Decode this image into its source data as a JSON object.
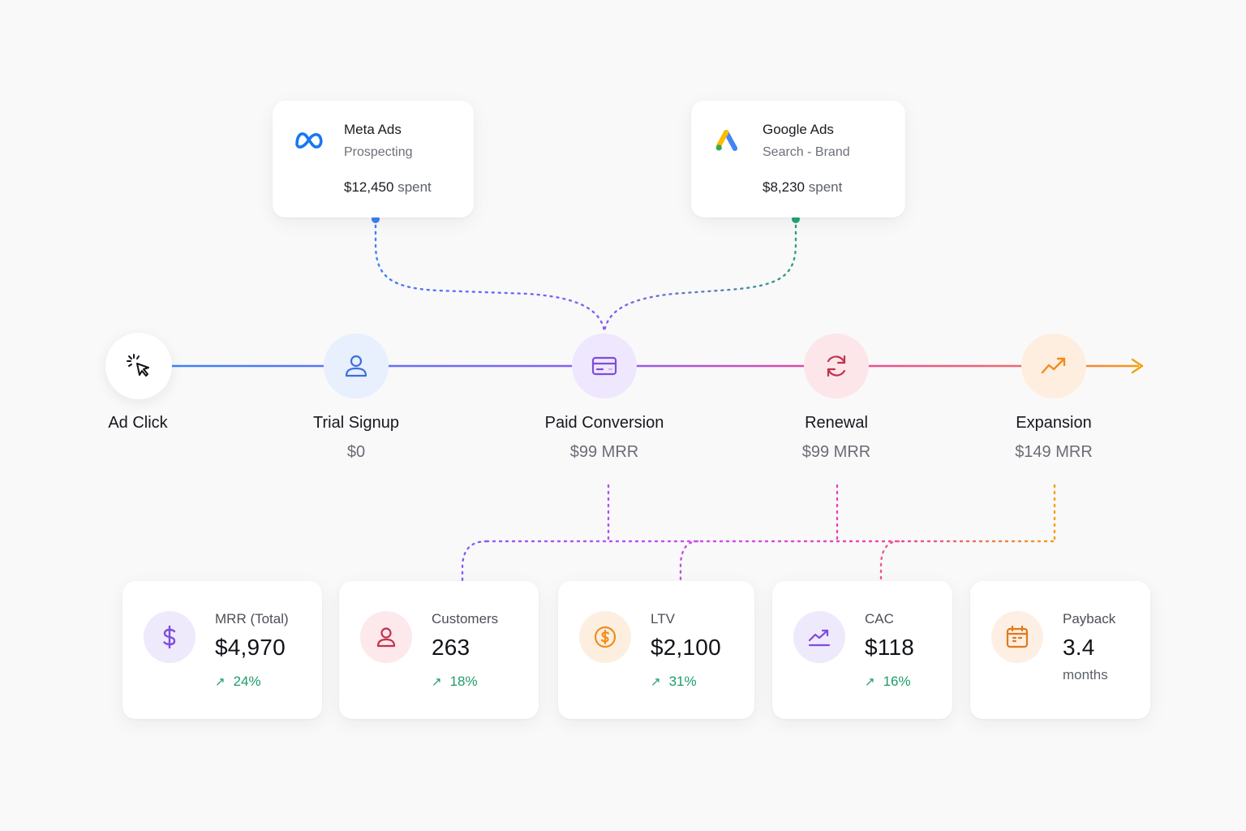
{
  "sources": [
    {
      "name": "Meta Ads",
      "subtitle": "Prospecting",
      "amount": "$12,450",
      "unit": "spent",
      "icon": "meta-logo-icon",
      "color": "#3b82f6"
    },
    {
      "name": "Google Ads",
      "subtitle": "Search - Brand",
      "amount": "$8,230",
      "unit": "spent",
      "icon": "google-ads-logo-icon",
      "color": "#22a871"
    }
  ],
  "steps": [
    {
      "label": "Ad Click",
      "value": "",
      "icon": "cursor-click-icon",
      "color": "#111318"
    },
    {
      "label": "Trial Signup",
      "value": "$0",
      "icon": "user-icon",
      "color": "#3b6fe0"
    },
    {
      "label": "Paid Conversion",
      "value": "$99 MRR",
      "icon": "credit-card-icon",
      "color": "#7c4ddb"
    },
    {
      "label": "Renewal",
      "value": "$99 MRR",
      "icon": "refresh-icon",
      "color": "#c2334d"
    },
    {
      "label": "Expansion",
      "value": "$149 MRR",
      "icon": "trending-up-icon",
      "color": "#f28c1c"
    }
  ],
  "metrics": [
    {
      "label": "MRR (Total)",
      "value": "$4,970",
      "delta": "24%",
      "sub": "",
      "icon": "dollar-icon",
      "color": "#7c4ddb"
    },
    {
      "label": "Customers",
      "value": "263",
      "delta": "18%",
      "sub": "",
      "icon": "user-icon",
      "color": "#c2334d"
    },
    {
      "label": "LTV",
      "value": "$2,100",
      "delta": "31%",
      "sub": "",
      "icon": "coin-icon",
      "color": "#f28c1c"
    },
    {
      "label": "CAC",
      "value": "$118",
      "delta": "16%",
      "sub": "",
      "icon": "chart-line-icon",
      "color": "#7c4ddb"
    },
    {
      "label": "Payback",
      "value": "3.4",
      "delta": "",
      "sub": "months",
      "icon": "calendar-icon",
      "color": "#e07a1a"
    }
  ],
  "colors": {
    "flow_start": "#3b82f6",
    "flow_mid": "#8b5cf6",
    "flow_pink": "#ec4899",
    "flow_end": "#f59e0b",
    "delta_up": "#1f9b6a"
  }
}
